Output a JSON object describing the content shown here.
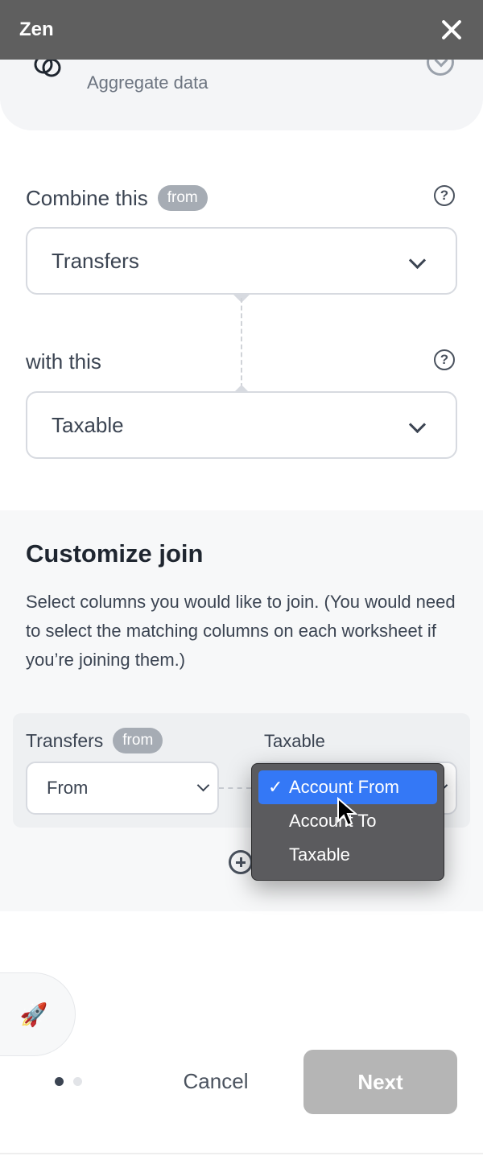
{
  "window": {
    "title": "Zen",
    "close_icon": "close-icon"
  },
  "aggregate_card": {
    "subtitle": "Aggregate data",
    "icon": "link-rings-icon",
    "status_icon": "check-circle-icon"
  },
  "combine": {
    "label": "Combine this",
    "badge": "from",
    "help_glyph": "?",
    "selected": "Transfers"
  },
  "with_this": {
    "label": "with this",
    "help_glyph": "?",
    "selected": "Taxable"
  },
  "customize": {
    "title": "Customize join",
    "description": "Select columns you would like to join. (You would need to select the matching columns on each worksheet if you’re joining them.)",
    "left_table": "Transfers",
    "left_badge": "from",
    "left_selected": "From",
    "right_table": "Taxable",
    "add_icon": "plus-circle-icon"
  },
  "dropdown": {
    "check_glyph": "✓",
    "options": [
      "Account From",
      "Account To",
      "Taxable"
    ],
    "selected_index": 0,
    "highlight_color": "#3478f6"
  },
  "footer": {
    "rocket_glyph": "🚀",
    "cancel_label": "Cancel",
    "next_label": "Next",
    "page_count": 2,
    "current_page": 1
  }
}
